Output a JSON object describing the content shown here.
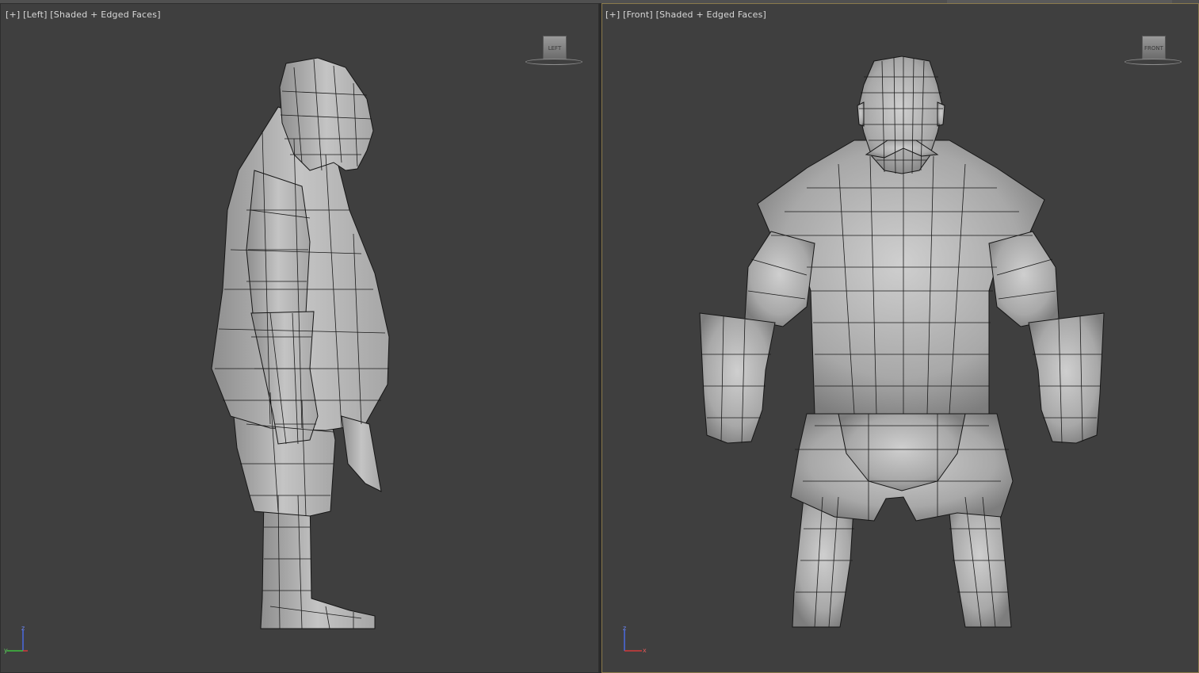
{
  "viewports": {
    "left": {
      "plus": "[+]",
      "view": "[Left]",
      "shading": "[Shaded + Edged Faces]",
      "viewcube_label": "LEFT"
    },
    "front": {
      "plus": "[+]",
      "view": "[Front]",
      "shading": "[Shaded + Edged Faces]",
      "viewcube_label": "FRONT"
    }
  },
  "axis_labels": {
    "z": "z",
    "y": "y",
    "x": "x"
  },
  "colors": {
    "viewport_bg": "#3f3f3f",
    "active_border": "#8a7a4c",
    "mesh_fill": "#b8b8b8",
    "mesh_edge": "#1a1a1a"
  }
}
